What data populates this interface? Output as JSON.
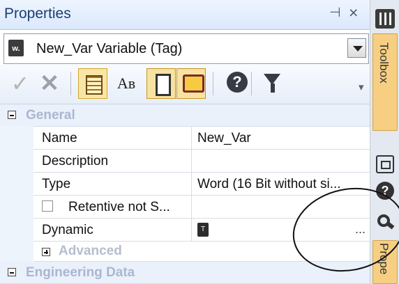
{
  "panel": {
    "title": "Properties",
    "pin_icon": "pin-icon",
    "close_icon": "close-icon"
  },
  "selector": {
    "icon": "tag-variable-icon",
    "icon_text": "w.",
    "text": "New_Var Variable (Tag)"
  },
  "toolbar": {
    "buttons": [
      {
        "name": "accept-icon"
      },
      {
        "name": "cancel-icon"
      },
      {
        "name": "categorized-view-icon"
      },
      {
        "name": "alphabetical-view-icon"
      },
      {
        "name": "property-pages-icon"
      },
      {
        "name": "comment-icon"
      },
      {
        "name": "help-icon"
      },
      {
        "name": "filter-icon"
      }
    ],
    "alphabetical_label": "Aʙ"
  },
  "categories": {
    "general": "General",
    "advanced": "Advanced",
    "engineering": "Engineering Data"
  },
  "rows": [
    {
      "name": "Name",
      "value": "New_Var"
    },
    {
      "name": "Description",
      "value": ""
    },
    {
      "name": "Type",
      "value": "Word (16 Bit without si..."
    },
    {
      "name": "Retentive not S...",
      "value": ""
    },
    {
      "name": "Dynamic",
      "value": "..."
    }
  ],
  "dynamic_icon_text": "T",
  "right_strip": {
    "toolbox_tab": "Toolbox",
    "properties_tab": "Prope"
  },
  "colors": {
    "accent": "#f6cf83",
    "panel_title": "#1b3d74",
    "category_bg": "#eaf1fb"
  }
}
